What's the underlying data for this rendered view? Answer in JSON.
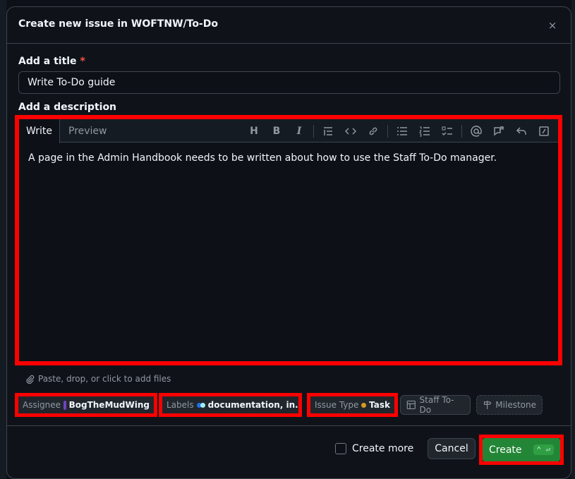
{
  "dialog": {
    "title": "Create new issue in WOFTNW/To-Do",
    "close_icon": "×"
  },
  "title_field": {
    "label": "Add a title",
    "required_mark": "*",
    "value": "Write To-Do guide"
  },
  "description": {
    "label": "Add a description",
    "tabs": {
      "write": "Write",
      "preview": "Preview"
    },
    "heading_tool": "H",
    "bold_tool": "B",
    "italic_tool": "I",
    "text": "A page in the Admin Handbook needs to be written about how to use the Staff To-Do manager."
  },
  "attach": {
    "text": "Paste, drop, or click to add files"
  },
  "metadata": {
    "assignee": {
      "key": "Assignee",
      "value": "BogTheMudWing"
    },
    "labels": {
      "key": "Labels",
      "value": "documentation, in..."
    },
    "issue_type": {
      "key": "Issue Type",
      "value": "Task"
    },
    "project": {
      "label": "Staff To-Do"
    },
    "milestone": {
      "label": "Milestone"
    }
  },
  "footer": {
    "create_more": "Create more",
    "cancel": "Cancel",
    "create": "Create",
    "create_shortcut": "⌃ ⏎"
  },
  "colors": {
    "highlight": "#ff0000",
    "primary_button": "#238636",
    "label_dot_1": "#1f6feb",
    "label_dot_2": "#a2eeef",
    "task_dot": "#d29922"
  }
}
